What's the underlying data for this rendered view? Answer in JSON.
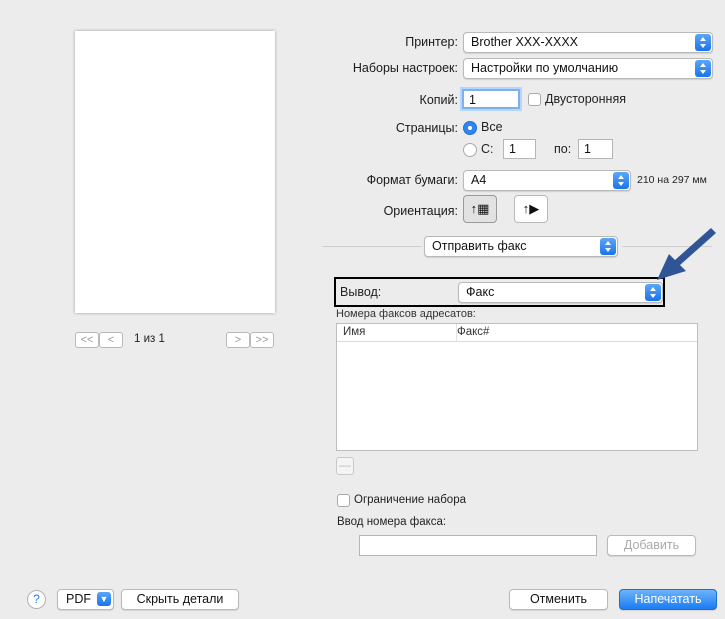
{
  "printer": {
    "label": "Принтер:",
    "value": "Brother XXX-XXXX"
  },
  "presets": {
    "label": "Наборы настроек:",
    "value": "Настройки по умолчанию"
  },
  "copies": {
    "label": "Копий:",
    "value": "1",
    "duplex_label": "Двусторонняя"
  },
  "pages": {
    "label": "Страницы:",
    "all_label": "Все",
    "from_label": "С:",
    "from_value": "1",
    "to_label": "по:",
    "to_value": "1"
  },
  "paper": {
    "label": "Формат бумаги:",
    "value": "A4",
    "size_text": "210 на 297 мм"
  },
  "orientation": {
    "label": "Ориентация:"
  },
  "section_popup": {
    "value": "Отправить факс"
  },
  "output": {
    "label": "Вывод:",
    "value": "Факс"
  },
  "recipients": {
    "label": "Номера факсов адресатов:",
    "columns": [
      "Имя",
      "Факс#"
    ]
  },
  "dial_restriction_label": "Ограничение набора",
  "fax_number": {
    "label": "Ввод номера факса:",
    "value": "",
    "add_label": "Добавить"
  },
  "pager": {
    "first": "<<",
    "prev": "<",
    "text": "1 из 1",
    "next": ">",
    "last": ">>"
  },
  "footer": {
    "help": "?",
    "pdf": "PDF",
    "hide_details": "Скрыть детали",
    "cancel": "Отменить",
    "print": "Напечатать"
  },
  "colors": {
    "accent": "#1c7cf2",
    "arrow": "#2f5597",
    "highlight_box": "#000000"
  }
}
